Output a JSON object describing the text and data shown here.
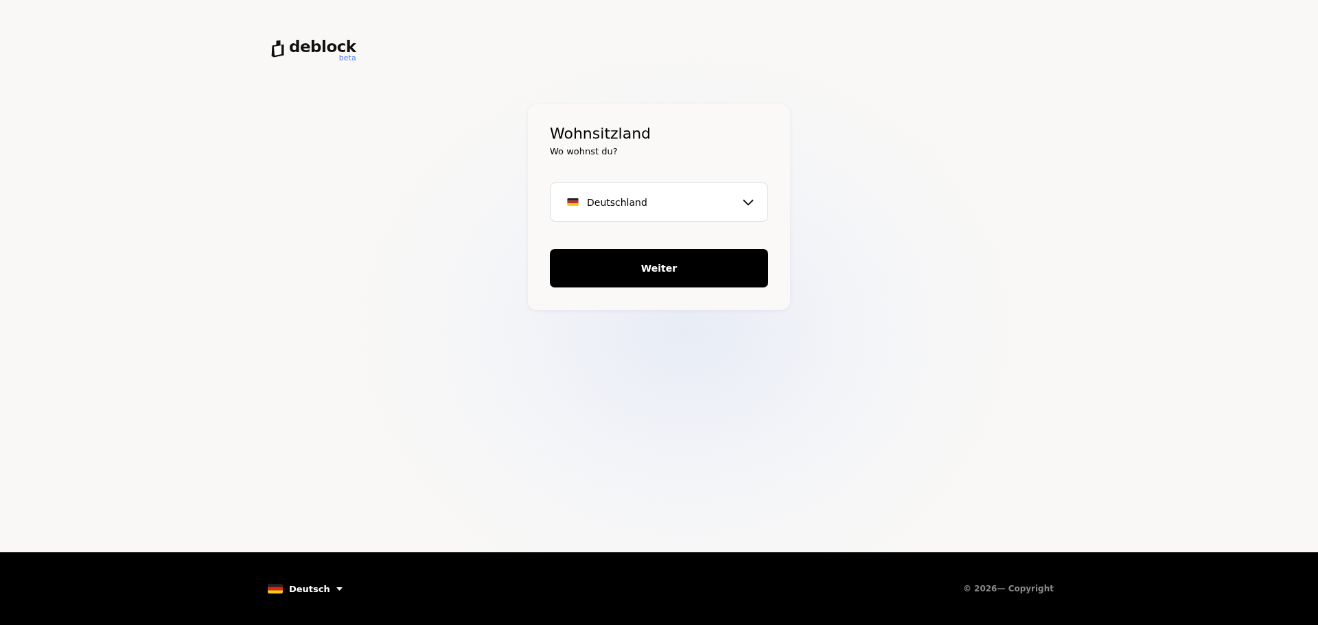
{
  "logo": {
    "name": "deblock",
    "badge": "beta"
  },
  "card": {
    "title": "Wohnsitzland",
    "subtitle": "Wo wohnst du?",
    "country_select": {
      "value": "Deutschland"
    },
    "button": "Weiter"
  },
  "footer": {
    "language": "Deutsch",
    "copyright": "© 2026— Copyright"
  }
}
